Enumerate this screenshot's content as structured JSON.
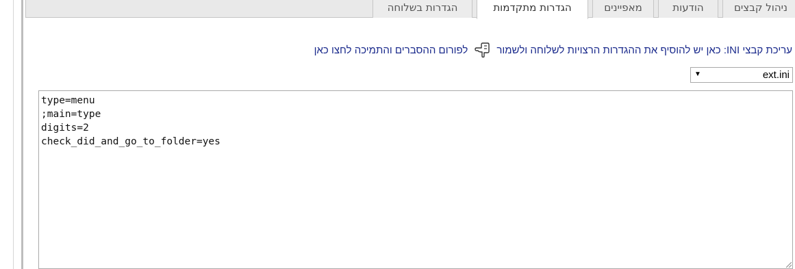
{
  "tabs": [
    {
      "label": "ניהול קבצים",
      "active": false
    },
    {
      "label": "הודעות",
      "active": false
    },
    {
      "label": "מאפיינים",
      "active": false
    },
    {
      "label": "הגדרות מתקדמות",
      "active": true
    },
    {
      "label": "הגדרות בשלוחה",
      "active": false
    }
  ],
  "help": {
    "text": "עריכת קבצי INI: כאן יש להוסיף את ההגדרות הרצויות לשלוחה ולשמור",
    "icon": "pointing-hand-icon",
    "link": "לפורום ההסברים והתמיכה לחצו כאן"
  },
  "file_select": {
    "value": "ext.ini"
  },
  "editor": {
    "content": "type=menu\n;main=type\ndigits=2\ncheck_did_and_go_to_folder=yes"
  },
  "colors": {
    "link": "#1a2a8c",
    "tab_bg": "#ececec",
    "active_tab_bg": "#ffffff"
  }
}
